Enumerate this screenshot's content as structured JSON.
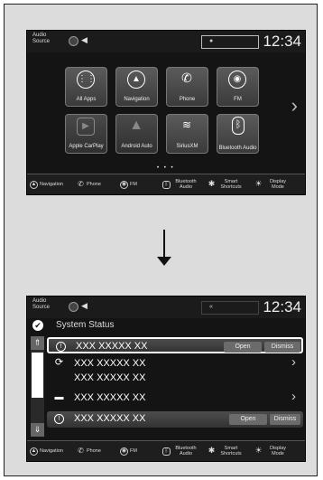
{
  "screen1": {
    "audio_source": "Audio Source",
    "clock": "12:34",
    "tiles": [
      {
        "label": "All Apps",
        "icon": "grid-icon",
        "glyph": "⋮⋮"
      },
      {
        "label": "Navigation",
        "icon": "navigation-icon",
        "glyph": "▲"
      },
      {
        "label": "Phone",
        "icon": "phone-icon",
        "glyph": "✆"
      },
      {
        "label": "FM",
        "icon": "radio-icon",
        "glyph": "◉"
      },
      {
        "label": "Apple CarPlay",
        "icon": "carplay-icon",
        "glyph": "▶"
      },
      {
        "label": "Android Auto",
        "icon": "android-auto-icon",
        "glyph": "▲"
      },
      {
        "label": "SiriusXM",
        "icon": "siriusxm-icon",
        "glyph": "≋"
      },
      {
        "label": "Bluetooth Audio",
        "icon": "bluetooth-icon",
        "glyph": "ᛒ"
      }
    ],
    "page_indicator": "• • •"
  },
  "bottombar": [
    {
      "label": "Navigation",
      "icon": "navigation-icon",
      "glyph": "▲"
    },
    {
      "label": "Phone",
      "icon": "phone-icon",
      "glyph": "✆"
    },
    {
      "label": "FM",
      "icon": "radio-icon",
      "glyph": "◉"
    },
    {
      "label": "Bluetooth Audio",
      "icon": "bluetooth-icon",
      "glyph": "ᛒ"
    },
    {
      "label": "Smart Shortcuts",
      "icon": "smart-shortcuts-icon",
      "glyph": "✱"
    },
    {
      "label": "Display Mode",
      "icon": "display-mode-icon",
      "glyph": "☀"
    }
  ],
  "screen2": {
    "audio_source": "Audio Source",
    "clock": "12:34",
    "title": "System Status",
    "rows": [
      {
        "text": "XXX XXXXX XX",
        "icon": "alert-icon",
        "open": "Open",
        "dismiss": "Dismiss"
      },
      {
        "text": "XXX XXXXX XX",
        "icon": "sync-icon"
      },
      {
        "text": "XXX XXXXX XX"
      },
      {
        "text": "XXX XXXXX XX",
        "icon": "car-icon"
      },
      {
        "text": "XXX XXXXX XX",
        "icon": "alert-icon",
        "open": "Open",
        "dismiss": "Dismiss"
      }
    ]
  }
}
